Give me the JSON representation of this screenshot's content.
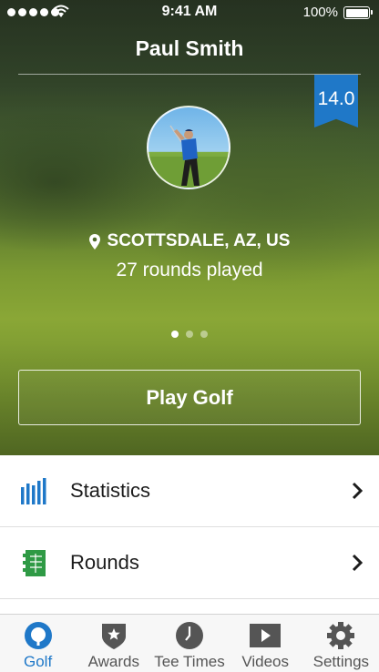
{
  "status_bar": {
    "time": "9:41 AM",
    "battery": "100%"
  },
  "profile": {
    "name": "Paul Smith",
    "handicap": "14.0",
    "location": "SCOTTSDALE, AZ, US",
    "rounds_played": "27 rounds played",
    "pager": {
      "pages": 3,
      "active_page": 1
    }
  },
  "play_button": {
    "label": "Play Golf"
  },
  "menu": {
    "items": [
      {
        "label": "Statistics",
        "icon": "bar-chart-icon"
      },
      {
        "label": "Rounds",
        "icon": "scorecard-icon"
      }
    ]
  },
  "tab_bar": {
    "tabs": [
      {
        "label": "Golf",
        "icon": "golf-ball-icon",
        "active": true
      },
      {
        "label": "Awards",
        "icon": "award-shield-icon",
        "active": false
      },
      {
        "label": "Tee Times",
        "icon": "clock-icon",
        "active": false
      },
      {
        "label": "Videos",
        "icon": "play-icon",
        "active": false
      },
      {
        "label": "Settings",
        "icon": "gear-icon",
        "active": false
      }
    ]
  },
  "colors": {
    "accent": "#1f78c8",
    "rounds_icon": "#2f9a45",
    "inactive_icon": "#555555"
  }
}
